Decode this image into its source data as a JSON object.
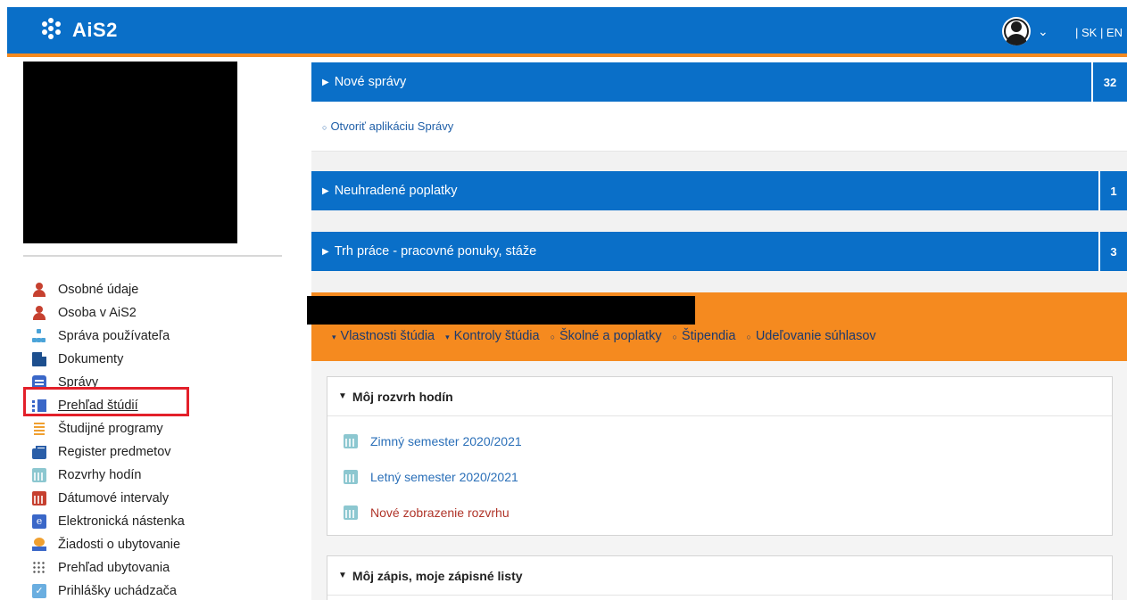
{
  "header": {
    "app_name": "AiS2",
    "languages": "| SK | EN"
  },
  "sidebar": {
    "items": [
      {
        "label": "Osobné údaje",
        "icon": "person-icon"
      },
      {
        "label": "Osoba v AiS2",
        "icon": "person-icon"
      },
      {
        "label": "Správa používateľa",
        "icon": "org-chart-icon"
      },
      {
        "label": "Dokumenty",
        "icon": "document-icon"
      },
      {
        "label": "Správy",
        "icon": "message-icon"
      },
      {
        "label": "Prehľad štúdií",
        "icon": "study-overview-icon"
      },
      {
        "label": "Študijné programy",
        "icon": "list-icon"
      },
      {
        "label": "Register predmetov",
        "icon": "briefcase-icon"
      },
      {
        "label": "Rozvrhy hodín",
        "icon": "calendar-icon"
      },
      {
        "label": "Dátumové intervaly",
        "icon": "calendar-icon"
      },
      {
        "label": "Elektronická nástenka",
        "icon": "e-board-icon"
      },
      {
        "label": "Žiadosti o ubytovanie",
        "icon": "accommodation-icon"
      },
      {
        "label": "Prehľad ubytovania",
        "icon": "grid-icon"
      },
      {
        "label": "Prihlášky uchádzača",
        "icon": "checkbox-icon"
      }
    ]
  },
  "panels": {
    "messages": {
      "title": "Nové správy",
      "count": "32",
      "link": "Otvoriť aplikáciu Správy"
    },
    "fees": {
      "title": "Neuhradené poplatky",
      "count": "1"
    },
    "jobs": {
      "title": "Trh práce - pracovné ponuky, stáže",
      "count": "3"
    }
  },
  "study": {
    "links": [
      {
        "label": "Vlastnosti štúdia",
        "mark": "▾"
      },
      {
        "label": "Kontroly štúdia",
        "mark": "▾"
      },
      {
        "label": "Školné a poplatky",
        "mark": "○"
      },
      {
        "label": "Štipendia",
        "mark": "○"
      },
      {
        "label": "Udeľovanie súhlasov",
        "mark": "○"
      }
    ]
  },
  "schedule": {
    "title": "Môj rozvrh hodín",
    "rows": [
      {
        "label": "Zimný semester 2020/2021"
      },
      {
        "label": "Letný semester 2020/2021"
      },
      {
        "label": "Nové zobrazenie rozvrhu"
      }
    ]
  },
  "enrollment": {
    "title": "Môj zápis, moje zápisné listy"
  },
  "colors": {
    "header_blue": "#0a6fc8",
    "accent_orange": "#f58a1f",
    "highlight_red": "#e3202a"
  }
}
